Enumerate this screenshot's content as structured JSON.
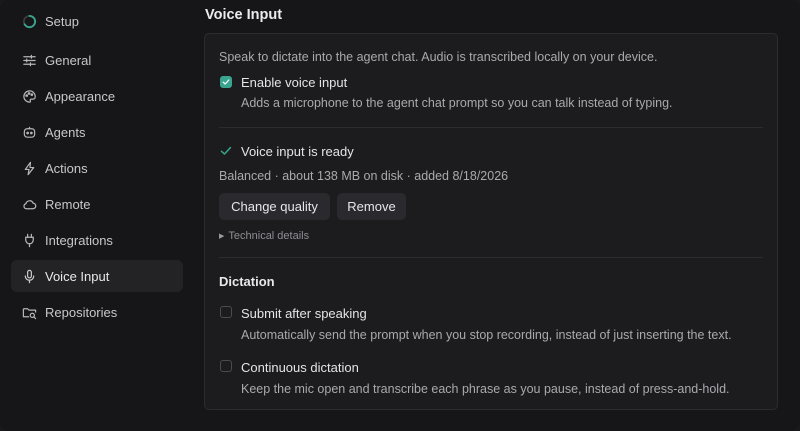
{
  "sidebar": {
    "items": [
      {
        "label": "Setup",
        "icon": "progress-ring-icon"
      },
      {
        "label": "General",
        "icon": "sliders-icon"
      },
      {
        "label": "Appearance",
        "icon": "palette-icon"
      },
      {
        "label": "Agents",
        "icon": "agent-face-icon"
      },
      {
        "label": "Actions",
        "icon": "lightning-icon"
      },
      {
        "label": "Remote",
        "icon": "cloud-icon"
      },
      {
        "label": "Integrations",
        "icon": "plug-icon"
      },
      {
        "label": "Voice Input",
        "icon": "microphone-icon",
        "active": true
      },
      {
        "label": "Repositories",
        "icon": "folder-search-icon"
      }
    ]
  },
  "page": {
    "title": "Voice Input"
  },
  "voice": {
    "intro": "Speak to dictate into the agent chat. Audio is transcribed locally on your device.",
    "enable_label": "Enable voice input",
    "enable_checked": true,
    "enable_desc": "Adds a microphone to the agent chat prompt so you can talk instead of typing.",
    "status_label": "Voice input is ready",
    "model_info": "Balanced · about 138 MB on disk · added 8/18/2026",
    "change_quality_label": "Change quality",
    "remove_label": "Remove",
    "technical_details_label": "Technical details"
  },
  "dictation": {
    "heading": "Dictation",
    "submit_label": "Submit after speaking",
    "submit_checked": false,
    "submit_desc": "Automatically send the prompt when you stop recording, instead of just inserting the text.",
    "continuous_label": "Continuous dictation",
    "continuous_checked": false,
    "continuous_desc": "Keep the mic open and transcribe each phrase as you pause, instead of press-and-hold."
  },
  "colors": {
    "accent": "#3aa58f",
    "background": "#161618",
    "card": "#1c1c1f"
  }
}
